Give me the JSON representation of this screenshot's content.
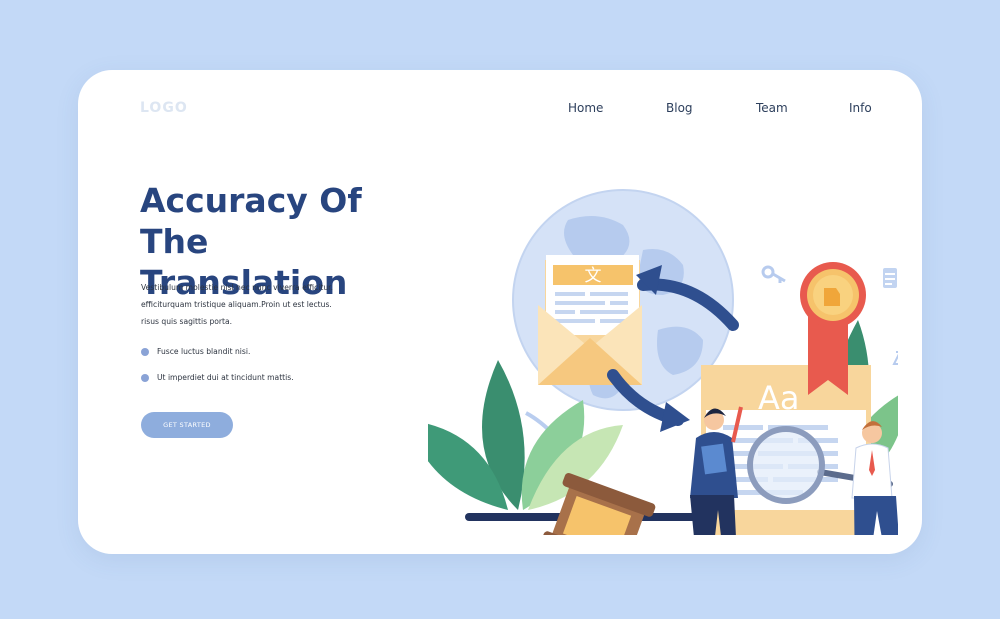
{
  "header": {
    "logo": "LOGO",
    "nav": [
      "Home",
      "Blog",
      "Team",
      "Info"
    ]
  },
  "hero": {
    "title_line1": "Accuracy Of The",
    "title_line2": "Translation",
    "description": [
      "Vestibulum molestie nisl nec nunc viverra efficitur.",
      "efficiturquam tristique aliquam.Proin ut est lectus.",
      "risus quis sagittis porta."
    ],
    "bullets": [
      "Fusce luctus blandit nisi.",
      "Ut imperdiet dui at tincidunt mattis."
    ],
    "cta_label": "GET STARTED"
  },
  "illustration": {
    "envelope_glyph": "文",
    "document_text": "Aa"
  },
  "colors": {
    "background": "#c3d9f7",
    "title": "#28457f",
    "accent": "#8eaddd",
    "navy": "#2b3f7a",
    "orange": "#f6c36b",
    "green": "#3f9a78",
    "red": "#e85a4e"
  }
}
